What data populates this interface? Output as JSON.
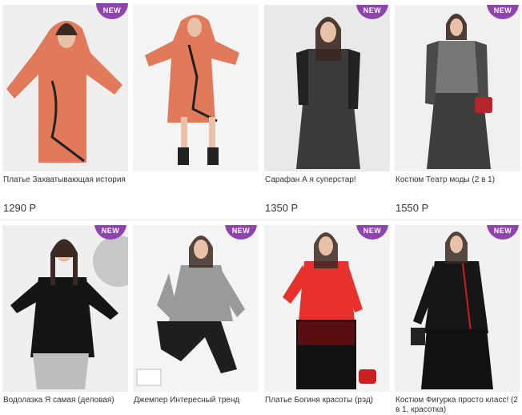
{
  "badge_label": "NEW",
  "colors": {
    "badge": "#8e44ad",
    "price_text": "#333333"
  },
  "products": [
    {
      "name": "Платье Захватывающая история",
      "price": "1290 Р",
      "badge": false
    },
    {
      "name": "",
      "price": "",
      "badge": false
    },
    {
      "name": "Сарафан А я суперстар!",
      "price": "1350 Р",
      "badge": true
    },
    {
      "name": "Костюм Театр моды (2 в 1)",
      "price": "1550 Р",
      "badge": true
    },
    {
      "name": "Водолазка Я самая (деловая)",
      "price": "",
      "badge": true
    },
    {
      "name": "Джемпер Интересный тренд",
      "price": "",
      "badge": true
    },
    {
      "name": "Платье Богиня красоты (рэд)",
      "price": "",
      "badge": true
    },
    {
      "name": "Костюм Фигурка просто класс! (2 в 1, красотка)",
      "price": "",
      "badge": true
    }
  ]
}
